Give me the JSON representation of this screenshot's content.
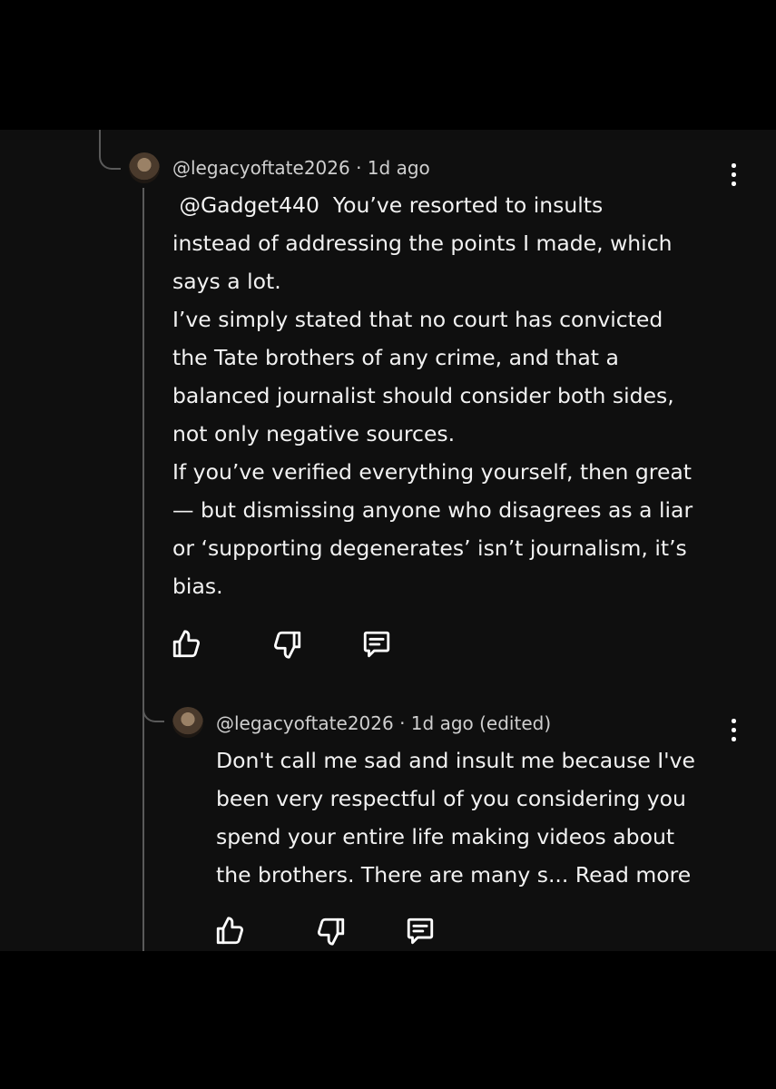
{
  "comment1": {
    "handle": "@legacyoftate2026",
    "separator": "·",
    "time": "1d ago",
    "lines": [
      " @Gadget440  You’ve resorted to insults",
      "instead of addressing the points I made, which",
      "says a lot.",
      "I’ve simply stated that no court has convicted",
      "the Tate brothers of any crime, and that a",
      "balanced journalist should consider both sides,",
      "not only negative sources.",
      "If you’ve verified everything yourself, then great",
      "— but dismissing anyone who disagrees as a liar",
      "or ‘supporting degenerates’ isn’t journalism, it’s",
      "bias."
    ]
  },
  "comment2": {
    "handle": "@legacyoftate2026",
    "separator": "·",
    "time": "1d ago (edited)",
    "lines": [
      "Don't call me sad and insult me because I've",
      "been very respectful of you considering you",
      "spend your entire life making videos about",
      "the brothers. There are many s... Read more"
    ]
  },
  "icons": {
    "like": "thumbs-up-icon",
    "dislike": "thumbs-down-icon",
    "reply": "reply-icon",
    "more": "more-vertical-icon"
  }
}
